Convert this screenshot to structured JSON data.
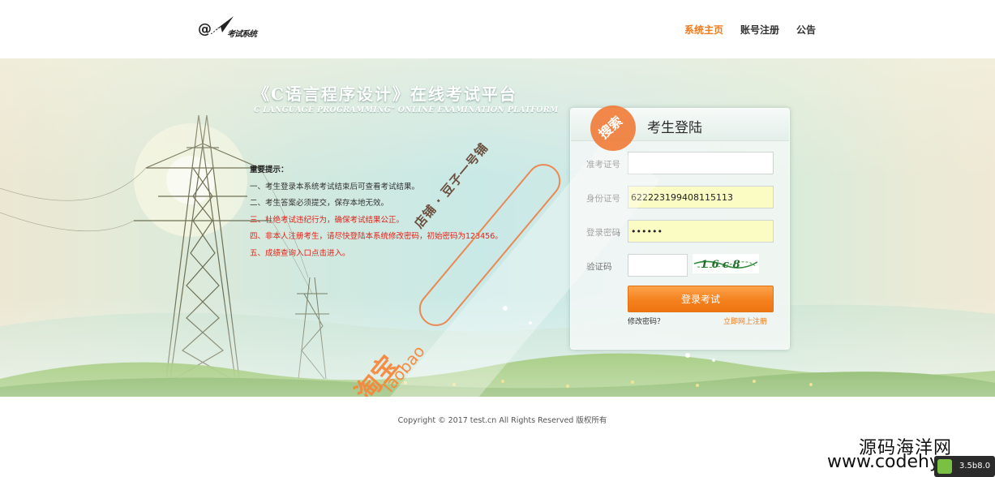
{
  "header": {
    "logo_mark": "@",
    "logo_text": "考试系统",
    "nav": [
      {
        "label": "系统主页",
        "active": true
      },
      {
        "label": "账号注册",
        "active": false
      },
      {
        "label": "公告",
        "active": false
      }
    ]
  },
  "banner": {
    "title_cn": "《C语言程序设计》在线考试平台",
    "title_en": "C LANGUAGE PROGRAMMING\" ONLINE EXAMINATION PLATFORM"
  },
  "notice": {
    "title": "重要提示：",
    "items": [
      {
        "text": "一、考生登录本系统考试结束后可查看考试结果。",
        "red": false
      },
      {
        "text": "二、考生答案必须提交，保存本地无效。",
        "red": false
      },
      {
        "text": "三、杜绝考试违纪行为，确保考试结果公正。",
        "red": true
      },
      {
        "text": "四、非本人注册考生，请尽快登陆本系统修改密码，初始密码为123456。",
        "red": true
      },
      {
        "text": "五、成绩查询入口点击进入。",
        "red": true
      }
    ]
  },
  "login": {
    "title": "考生登陆",
    "fields": {
      "exam_number_label": "准考证号",
      "exam_number_value": "",
      "id_label": "身份证号",
      "id_value": "622223199408115113",
      "password_label": "登录密码",
      "password_value": "••••••",
      "captcha_label": "验证码",
      "captcha_value": "",
      "captcha_image_text": "1 6 c 8"
    },
    "submit_label": "登录考试",
    "forgot_link": "修改密码？",
    "register_link": "立即网上注册"
  },
  "watermark": {
    "search": "搜索",
    "shop": "店铺 · 豆子一号铺",
    "taobao_cn": "淘宝",
    "taobao_en": "Taobao"
  },
  "footer": {
    "copyright": "Copyright © 2017 test.cn All Rights Reserved    版权所有"
  },
  "overlay": {
    "brand": "源码海洋网",
    "url": "www.codehy.com",
    "badge": "3.5b8.0"
  },
  "colors": {
    "accent": "#f27a1d",
    "notice_red": "#e0241a",
    "button_orange": "#f5821e",
    "autofill_yellow": "#fbfbc4"
  }
}
